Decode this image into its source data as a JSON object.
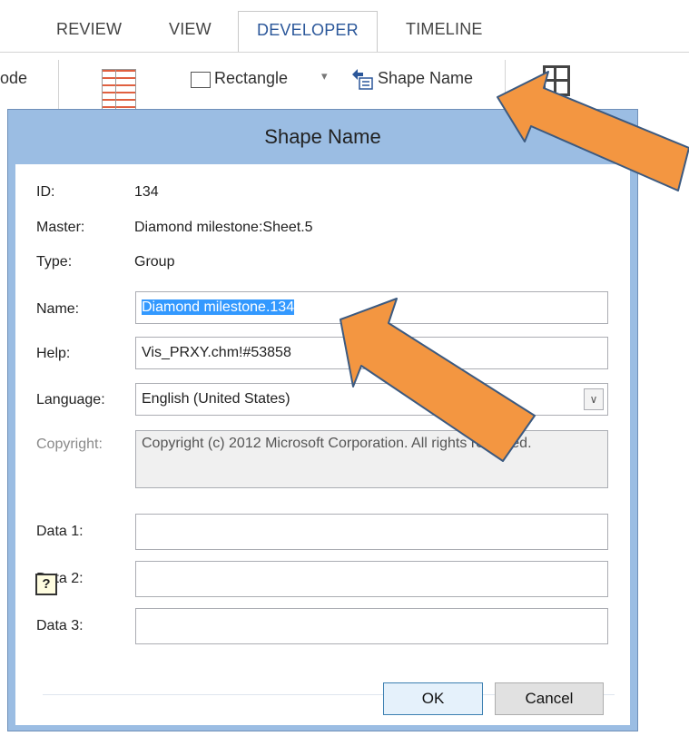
{
  "ribbon": {
    "tabs": [
      "REVIEW",
      "VIEW",
      "DEVELOPER",
      "TIMELINE"
    ],
    "active_tab": "DEVELOPER",
    "left_fragment": "ode",
    "rectangle_label": "Rectangle",
    "dropdown_glyph": "▾",
    "shape_name_label": "Shape Name"
  },
  "dialog": {
    "title": "Shape Name",
    "id_label": "ID:",
    "id_value": "134",
    "master_label": "Master:",
    "master_value": "Diamond milestone:Sheet.5",
    "type_label": "Type:",
    "type_value": "Group",
    "name_label": "Name:",
    "name_value": "Diamond milestone.134",
    "help_label": "Help:",
    "help_value": "Vis_PRXY.chm!#53858",
    "language_label": "Language:",
    "language_value": "English (United States)",
    "copyright_label": "Copyright:",
    "copyright_value": "Copyright (c) 2012 Microsoft Corporation.  All rights reserved.",
    "data1_label": "Data 1:",
    "data1_value": "",
    "data2_label": "Data 2:",
    "data2_value": "",
    "data3_label": "Data 3:",
    "data3_value": "",
    "help_button_glyph": "?",
    "ok_label": "OK",
    "cancel_label": "Cancel"
  },
  "colors": {
    "title_bar": "#9bbde3",
    "active_tab_text": "#2b579a",
    "selection": "#3399ff",
    "arrow_fill": "#f39641",
    "arrow_stroke": "#3c5a80"
  }
}
